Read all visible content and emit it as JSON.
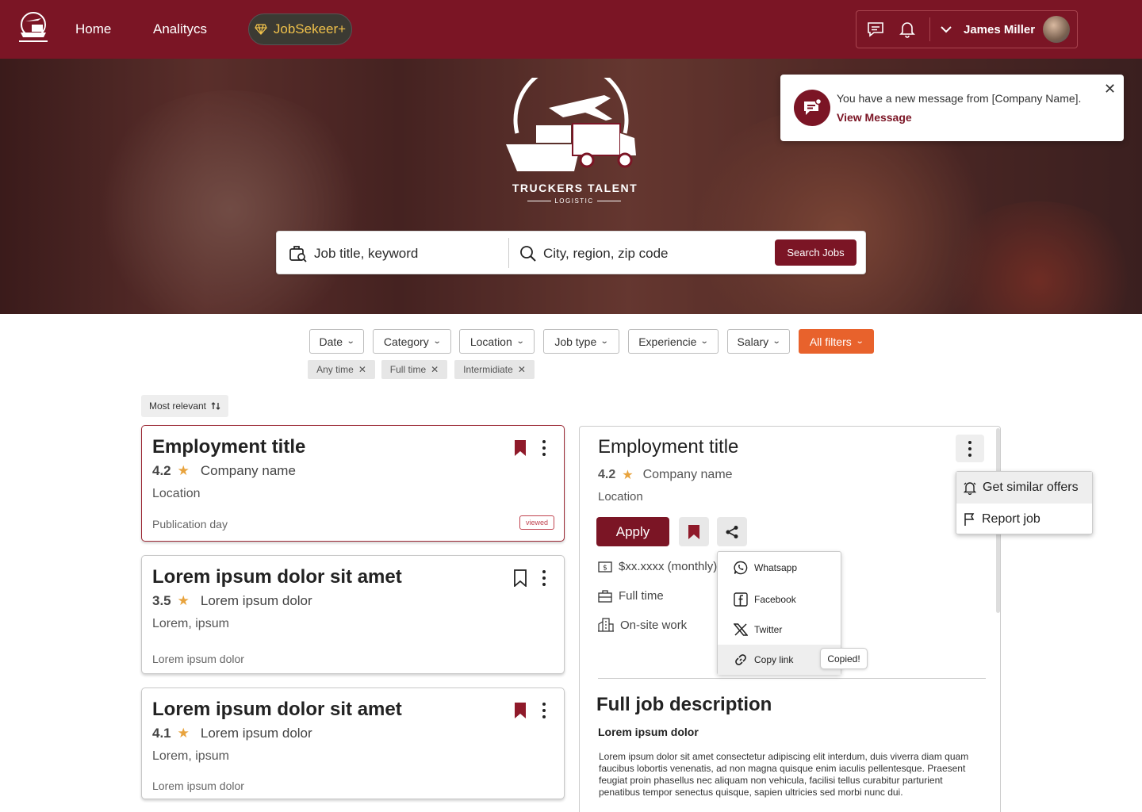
{
  "topbar": {
    "nav": [
      "Home",
      "Analitycs"
    ],
    "premium_label": "JobSekeer+",
    "user_name": "James Miller",
    "icons": [
      "chat-icon",
      "bell-icon",
      "chevron-down-icon"
    ]
  },
  "hero": {
    "brand_name": "TRUCKERS TALENT",
    "brand_tagline": "LOGISTIC"
  },
  "search": {
    "keyword_placeholder": "Job title, keyword",
    "location_placeholder": "City, region, zip code",
    "button_label": "Search Jobs"
  },
  "notification": {
    "message": "You have a new message from [Company Name].",
    "link": "View Message"
  },
  "filters": [
    {
      "label": "Date"
    },
    {
      "label": "Category"
    },
    {
      "label": "Location"
    },
    {
      "label": "Job type"
    },
    {
      "label": "Experiencie"
    },
    {
      "label": "Salary"
    },
    {
      "label": "All filters",
      "active": true
    }
  ],
  "active_chips": [
    "Any time",
    "Full time",
    "Intermidiate"
  ],
  "sort_label": "Most relevant",
  "job_cards": [
    {
      "title": "Employment title",
      "rating": "4.2",
      "company": "Company name",
      "location": "Location",
      "date": "Publication day",
      "saved": true,
      "viewed_badge": "viewed",
      "selected": true
    },
    {
      "title": "Lorem ipsum dolor sit amet",
      "rating": "3.5",
      "company": "Lorem ipsum dolor",
      "location": "Lorem, ipsum",
      "date": "Lorem ipsum dolor",
      "saved": false
    },
    {
      "title": "Lorem ipsum dolor sit amet",
      "rating": "4.1",
      "company": "Lorem ipsum dolor",
      "location": "Lorem, ipsum",
      "date": "Lorem ipsum dolor",
      "saved": true
    }
  ],
  "detail": {
    "title": "Employment title",
    "rating": "4.2",
    "company": "Company name",
    "location": "Location",
    "apply_label": "Apply",
    "salary": "$xx.xxxx (monthly)",
    "job_type": "Full time",
    "workplace": "On-site work",
    "section_title": "Full job description",
    "section_subtitle": "Lorem ipsum dolor",
    "description": "Lorem ipsum dolor sit amet consectetur adipiscing elit interdum, duis viverra diam quam faucibus lobortis venenatis, ad non magna quisque enim iaculis pellentesque. Praesent feugiat proin phasellus nec aliquam non vehicula, facilisi tellus curabitur parturient penatibus tempor senectus quisque, sapien ultricies sed morbi nunc dui."
  },
  "share_menu": {
    "items": [
      "Whatsapp",
      "Facebook",
      "Twitter",
      "Copy link"
    ],
    "copied_tooltip": "Copied!"
  },
  "more_menu": {
    "items": [
      "Get similar offers",
      "Report job"
    ]
  },
  "colors": {
    "brand": "#7b1525",
    "accent": "#e8622c",
    "premium_gold": "#f0c14b",
    "star": "#e8a33d"
  }
}
